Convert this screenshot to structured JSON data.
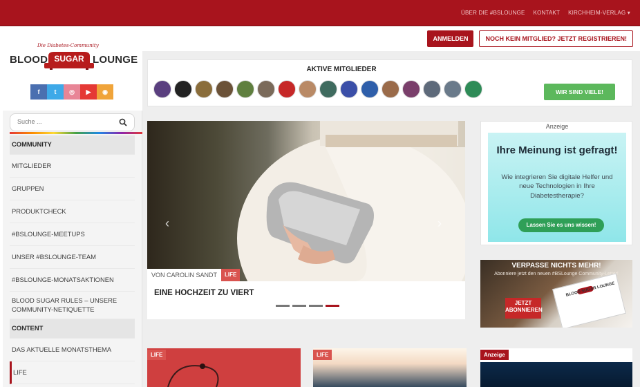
{
  "topbar": {
    "links": [
      "ÜBER DIE #BSLOUNGE",
      "KONTAKT",
      "KIRCHHEIM-VERLAG ▾"
    ]
  },
  "header": {
    "login_label": "ANMELDEN",
    "register_label": "NOCH KEIN MITGLIED? JETZT REGISTRIEREN!"
  },
  "logo": {
    "tagline": "Die Diabetes-Community",
    "word_left": "BLOOD",
    "word_center": "SUGAR",
    "word_right": "LOUNGE"
  },
  "social": [
    {
      "icon": "facebook-icon",
      "glyph": "f",
      "color": "#4a6fb0"
    },
    {
      "icon": "twitter-icon",
      "glyph": "t",
      "color": "#3ea9e8"
    },
    {
      "icon": "instagram-icon",
      "glyph": "◎",
      "color": "#e88596"
    },
    {
      "icon": "youtube-icon",
      "glyph": "▶",
      "color": "#e53935"
    },
    {
      "icon": "rss-icon",
      "glyph": "◉",
      "color": "#f0a43a"
    }
  ],
  "sidebar": {
    "search_placeholder": "Suche ...",
    "items": [
      {
        "label": "COMMUNITY",
        "type": "section"
      },
      {
        "label": "MITGLIEDER",
        "type": "link"
      },
      {
        "label": "GRUPPEN",
        "type": "link"
      },
      {
        "label": "PRODUKTCHECK",
        "type": "link"
      },
      {
        "label": "#BSLOUNGE-MEETUPS",
        "type": "link"
      },
      {
        "label": "UNSER #BSLOUNGE-TEAM",
        "type": "link"
      },
      {
        "label": "#BSLOUNGE-MONATSAKTIONEN",
        "type": "link"
      },
      {
        "label": "BLOOD SUGAR RULES – UNSERE COMMUNITY-NETIQUETTE",
        "type": "link-tall"
      },
      {
        "label": "CONTENT",
        "type": "section"
      },
      {
        "label": "DAS AKTUELLE MONATSTHEMA",
        "type": "link"
      },
      {
        "label": "LIFE",
        "type": "active"
      }
    ]
  },
  "members": {
    "title": "AKTIVE MITGLIEDER",
    "button_label": "WIR SIND VIELE!",
    "avatar_colors": [
      "#5a3f7f",
      "#222222",
      "#8a6d3b",
      "#6b5238",
      "#5f7f3f",
      "#7a6a5a",
      "#c62828",
      "#b98a66",
      "#3f6b5f",
      "#3b4fa8",
      "#2f5faa",
      "#9a6b4a",
      "#7a3f6b",
      "#5e6a7a",
      "#6a7a8a",
      "#2e8b57"
    ]
  },
  "slider": {
    "author": "VON CAROLIN SANDT",
    "category": "LIFE",
    "title": "EINE HOCHZEIT ZU VIERT",
    "prev_arrow": "‹",
    "next_arrow": "›"
  },
  "ad1": {
    "label": "Anzeige",
    "headline": "Ihre Meinung ist gefragt!",
    "text": "Wie integrieren Sie digitale Helfer und neue Technologien in Ihre Diabetestherapie?",
    "button_label": "Lassen Sie es uns wissen!"
  },
  "ad2": {
    "headline": "VERPASSE NICHTS MEHR!",
    "subtext": "Abonniere jetzt den neuen #BSLounge Community-Letter!",
    "button_label": "JETZT ABONNIEREN",
    "card_text": "BLOOD SUGAR LOUNGE"
  },
  "cards": [
    {
      "tag": "LIFE"
    },
    {
      "tag": "LIFE"
    },
    {
      "tag": "Anzeige"
    }
  ]
}
